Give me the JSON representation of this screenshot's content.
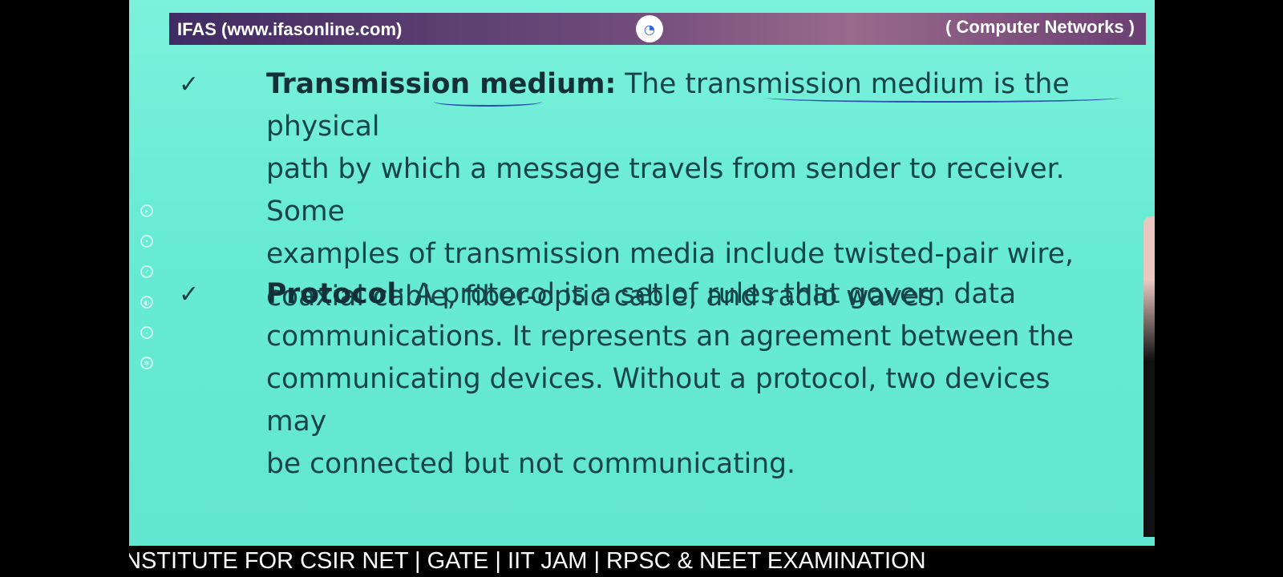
{
  "header": {
    "left_title": "IFAS (www.ifasonline.com)",
    "right_title": "( Computer Networks )",
    "logo_icon": "ifas-logo-icon"
  },
  "bullets": [
    {
      "term": "Transmission medium:",
      "lines": [
        " The transmission medium is the physical",
        "path by which a message travels from sender to receiver. Some",
        "examples of transmission media include twisted-pair wire,",
        "coaxial cable, fiber-optic cable, and radio waves."
      ]
    },
    {
      "term": "Protocol",
      "lines": [
        ":  A protocol is a set of rules that govern data",
        "communications. It represents an agreement between the",
        "communicating devices. Without a protocol, two devices may",
        "be connected but not communicating."
      ]
    }
  ],
  "check_glyph": "✓",
  "colors": {
    "slide_bg": "#67ebd2",
    "header_bg": "#6e4a7a",
    "text": "#17434a",
    "ink_underline": "#2b4fb0"
  },
  "side_tools": [
    "play-icon",
    "record-icon",
    "pen-icon",
    "highlighter-icon",
    "eraser-icon",
    "settings-icon"
  ],
  "ticker": {
    "text": "NSTITUTE FOR CSIR NET | GATE | IIT JAM | RPSC & NEET EXAMINATION"
  }
}
